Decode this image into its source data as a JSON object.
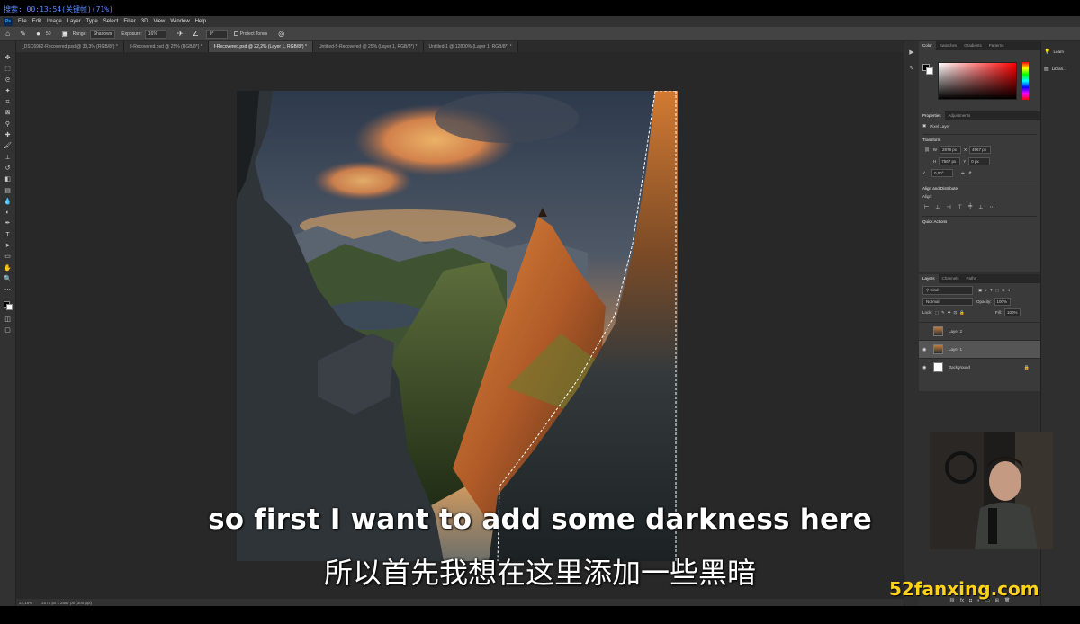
{
  "topbar": {
    "text": "搜索: 00:13:54(关键帧)(71%)"
  },
  "menu": {
    "logo": "Ps",
    "items": [
      "File",
      "Edit",
      "Image",
      "Layer",
      "Type",
      "Select",
      "Filter",
      "3D",
      "View",
      "Window",
      "Help"
    ]
  },
  "options": {
    "brush_size": "50",
    "range_label": "Range:",
    "range_value": "Shadows",
    "exposure_label": "Exposure:",
    "exposure_value": "16%",
    "angle_value": "0°",
    "protect_tones": "Protect Tones"
  },
  "tabs": [
    "_DSC6982-Recovered.psd @ 33,3% (RGB/8*) *",
    "d-Recovered.psd @ 25% (RGB/8*) *",
    "f-Recovered.psd @ 22,2% (Layer 1, RGB/8*) *",
    "Untitled-5-Recovered @ 25% (Layer 1, RGB/8*) *",
    "Untitled-1 @ 12800% (Layer 1, RGB/8*) *"
  ],
  "status": {
    "zoom": "22,16%",
    "doc": "2070 px x 2567 px (300 ppi)"
  },
  "panels": {
    "color_tabs": [
      "Color",
      "Swatches",
      "Gradients",
      "Patterns"
    ],
    "props_tabs": [
      "Properties",
      "Adjustments"
    ],
    "layer_type": "Pixel Layer",
    "transform_title": "Transform",
    "w_label": "W",
    "w_value": "2878 px",
    "h_label": "H",
    "h_value": "7567 px",
    "x_label": "X",
    "x_value": "4567 px",
    "y_label": "Y",
    "y_value": "0 px",
    "angle": "0,00°",
    "align_title": "Align and Distribute",
    "align_label": "Align:",
    "quick_actions": "Quick Actions",
    "layers_tabs": [
      "Layers",
      "Channels",
      "Paths"
    ],
    "kind": "Kind",
    "blend_mode": "Normal",
    "opacity_label": "Opacity:",
    "opacity": "100%",
    "lock_label": "Lock:",
    "fill_label": "Fill:",
    "fill": "100%",
    "layers": [
      {
        "name": "Layer 2",
        "visible": false
      },
      {
        "name": "Layer 1",
        "visible": true
      },
      {
        "name": "Background",
        "visible": true
      }
    ],
    "footer_icons": "fx"
  },
  "learn": {
    "learn": "Learn",
    "libraries": "Librari..."
  },
  "subtitles": {
    "en": "so first I want to add some darkness here",
    "zh": "所以首先我想在这里添加一些黑暗"
  },
  "watermark": "52fanxing.com"
}
